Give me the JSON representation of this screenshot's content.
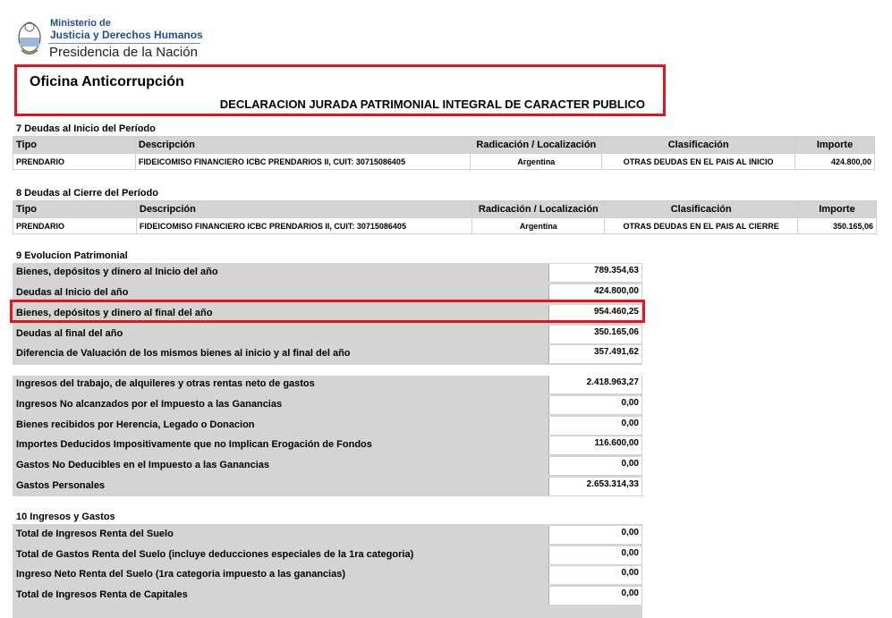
{
  "header": {
    "ministry_line1": "Ministerio de",
    "ministry_line2": "Justicia y Derechos Humanos",
    "presidencia": "Presidencia de la Nación",
    "office": "Oficina Anticorrupción",
    "declaration_title": "DECLARACION JURADA PATRIMONIAL INTEGRAL DE CARACTER PUBLICO"
  },
  "colors": {
    "highlight": "#e3141f",
    "brand_blue": "#1f4e8c",
    "grey_fill": "#d4d4d4"
  },
  "section7": {
    "title": "7 Deudas al Inicio del Período",
    "headers": [
      "Tipo",
      "Descripción",
      "Radicación / Localización",
      "Clasificación",
      "Importe"
    ],
    "row": [
      "PRENDARIO",
      "FIDEICOMISO FINANCIERO ICBC PRENDARIOS II, CUIT: 30715086405",
      "Argentina",
      "OTRAS DEUDAS EN EL PAIS AL INICIO",
      "424.800,00"
    ]
  },
  "section8": {
    "title": "8 Deudas al Cierre del Período",
    "headers": [
      "Tipo",
      "Descripción",
      "Radicación / Localización",
      "Clasificación",
      "Importe"
    ],
    "row": [
      "PRENDARIO",
      "FIDEICOMISO FINANCIERO ICBC PRENDARIOS II, CUIT: 30715086405",
      "Argentina",
      "OTRAS DEUDAS EN EL PAIS AL CIERRE",
      "350.165,06"
    ]
  },
  "section9": {
    "title": "9 Evolucion Patrimonial",
    "block1": [
      {
        "label": "Bienes, depósitos y dinero al Inicio del año",
        "value": "789.354,63"
      },
      {
        "label": "Deudas al Inicio del año",
        "value": "424.800,00"
      },
      {
        "label": "Bienes, depósitos y dinero al final del año",
        "value": "954.460,25"
      },
      {
        "label": "Deudas al final del año",
        "value": "350.165,06"
      },
      {
        "label": "Diferencia de Valuación de los mismos bienes al inicio y al final del año",
        "value": "357.491,62"
      }
    ],
    "block2": [
      {
        "label": "Ingresos del trabajo, de alquileres y otras rentas neto de gastos",
        "value": "2.418.963,27"
      },
      {
        "label": "Ingresos No alcanzados por el Impuesto a las Ganancias",
        "value": "0,00"
      },
      {
        "label": "Bienes recibidos por Herencia, Legado o Donacion",
        "value": "0,00"
      },
      {
        "label": "Importes Deducidos Impositivamente que no Implican Erogación de Fondos",
        "value": "116.600,00"
      },
      {
        "label": "Gastos No Deducibles en el Impuesto a las Ganancias",
        "value": "0,00"
      },
      {
        "label": "Gastos Personales",
        "value": "2.653.314,33"
      }
    ]
  },
  "section10": {
    "title": "10 Ingresos y Gastos",
    "rows": [
      {
        "label": "Total de Ingresos Renta del Suelo",
        "value": "0,00"
      },
      {
        "label": "Total de Gastos Renta del Suelo (incluye deducciones especiales de la 1ra categoria)",
        "value": "0,00"
      },
      {
        "label": "Ingreso Neto Renta del Suelo (1ra categoria impuesto a las ganancias)",
        "value": "0,00"
      },
      {
        "label": "Total de Ingresos Renta de Capitales",
        "value": "0,00"
      }
    ]
  }
}
